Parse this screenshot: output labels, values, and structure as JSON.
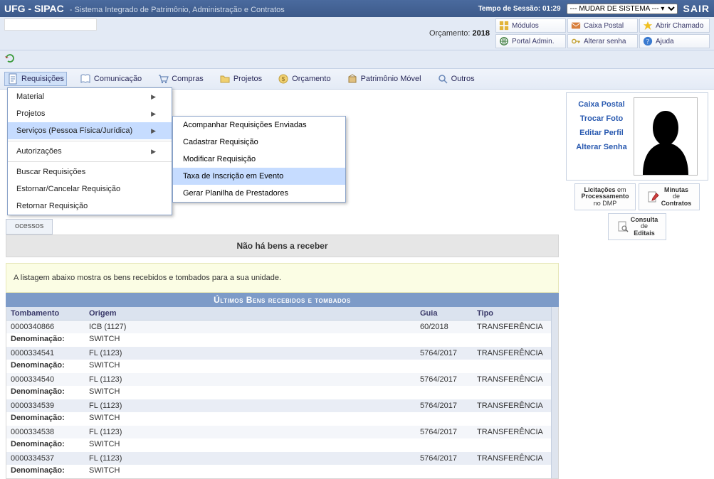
{
  "header": {
    "title": "UFG - SIPAC",
    "subtitle": "- Sistema Integrado de Patrimônio, Administração e Contratos",
    "session_label": "Tempo de Sessão:",
    "session_time": "01:29",
    "system_select": "--- MUDAR DE SISTEMA --- ▾",
    "sair": "SAIR"
  },
  "userbar": {
    "orcamento_label": "Orçamento:",
    "orcamento_year": "2018",
    "btns": {
      "modulos": "Módulos",
      "caixa": "Caixa Postal",
      "chamado": "Abrir Chamado",
      "portal": "Portal Admin.",
      "senha": "Alterar senha",
      "ajuda": "Ajuda"
    }
  },
  "menu": {
    "items": [
      "Requisições",
      "Comunicação",
      "Compras",
      "Projetos",
      "Orçamento",
      "Patrimônio Móvel",
      "Outros"
    ]
  },
  "dropdown": {
    "items": [
      {
        "label": "Material",
        "arrow": true
      },
      {
        "label": "Projetos",
        "arrow": true
      },
      {
        "label": "Serviços (Pessoa Física/Jurídica)",
        "arrow": true,
        "hover": true
      },
      {
        "label": "Autorizações",
        "arrow": true
      },
      {
        "label": "Buscar Requisições"
      },
      {
        "label": "Estornar/Cancelar Requisição"
      },
      {
        "label": "Retornar Requisição"
      }
    ]
  },
  "submenu": {
    "items": [
      {
        "label": "Acompanhar Requisições Enviadas"
      },
      {
        "label": "Cadastrar Requisição"
      },
      {
        "label": "Modificar Requisição"
      },
      {
        "label": "Taxa de Inscrição em Evento",
        "hover": true
      },
      {
        "label": "Gerar Planilha de Prestadores"
      }
    ]
  },
  "tabs": {
    "processos": "ocessos"
  },
  "panel": {
    "nobens": "Não há bens a receber",
    "info": "A listagem abaixo mostra os bens recebidos e tombados para a sua unidade.",
    "section": "Últimos Bens recebidos e tombados"
  },
  "table": {
    "headers": {
      "tombamento": "Tombamento",
      "origem": "Origem",
      "guia": "Guia",
      "tipo": "Tipo"
    },
    "denom_label": "Denominação:",
    "rows": [
      {
        "tomb": "0000340866",
        "origem": "ICB (1127)",
        "guia": "60/2018",
        "tipo": "TRANSFERÊNCIA",
        "denom": "SWITCH"
      },
      {
        "tomb": "0000334541",
        "origem": "FL (1123)",
        "guia": "5764/2017",
        "tipo": "TRANSFERÊNCIA",
        "denom": "SWITCH"
      },
      {
        "tomb": "0000334540",
        "origem": "FL (1123)",
        "guia": "5764/2017",
        "tipo": "TRANSFERÊNCIA",
        "denom": "SWITCH"
      },
      {
        "tomb": "0000334539",
        "origem": "FL (1123)",
        "guia": "5764/2017",
        "tipo": "TRANSFERÊNCIA",
        "denom": "SWITCH"
      },
      {
        "tomb": "0000334538",
        "origem": "FL (1123)",
        "guia": "5764/2017",
        "tipo": "TRANSFERÊNCIA",
        "denom": "SWITCH"
      },
      {
        "tomb": "0000334537",
        "origem": "FL (1123)",
        "guia": "5764/2017",
        "tipo": "TRANSFERÊNCIA",
        "denom": "SWITCH"
      }
    ]
  },
  "sidebar": {
    "links": [
      "Caixa Postal",
      "Trocar Foto",
      "Editar Perfil",
      "Alterar Senha"
    ],
    "shortcuts": {
      "licitacoes_l1": "Licitações",
      "licitacoes_l2": "em",
      "licitacoes_l3": "Processamento",
      "licitacoes_l4": "no DMP",
      "minutas_l1": "Minutas",
      "minutas_l2": "de",
      "minutas_l3": "Contratos",
      "editais_l1": "Consulta",
      "editais_l2": "de",
      "editais_l3": "Editais"
    }
  }
}
